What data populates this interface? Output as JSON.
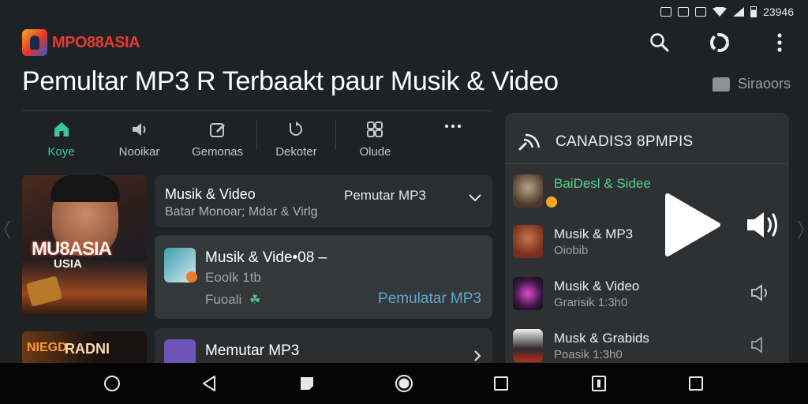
{
  "status": {
    "time": "23946"
  },
  "brand": {
    "name": "MPO88ASIA"
  },
  "header": {
    "title": "Pemultar MP3 R Terbaakt paur Musik & Video",
    "sort_label": "Siraoors"
  },
  "tabs": [
    {
      "label": "Koye",
      "icon": "home-icon",
      "active": true
    },
    {
      "label": "Nooikar",
      "icon": "volume-icon"
    },
    {
      "label": "Gemonas",
      "icon": "edit-box-icon"
    },
    {
      "label": "Dekoter",
      "icon": "refresh-icon"
    },
    {
      "label": "Olude",
      "icon": "grid-icon"
    },
    {
      "label": "",
      "icon": "more-horizontal-icon"
    }
  ],
  "thumbnails": {
    "big_caption": "MU8ASIA",
    "big_caption2": "USIA",
    "small_caption_left": "NIEGD",
    "small_caption": "RADNI"
  },
  "cards": {
    "card1": {
      "title": "Musik & Video",
      "subtitle": "Batar Monoar; Mdar & Virlg",
      "right_label": "Pemutar MP3"
    },
    "card2": {
      "title": "Musik & Vide•08 –",
      "subtitle": "Eoolk 1tb",
      "meta": "Fuoali",
      "action": "Pemulatar MP3"
    },
    "card3": {
      "title": "Memutar MP3"
    }
  },
  "panel": {
    "title": "CANADIS3 8PMPIS",
    "rows": [
      {
        "title": "BaiDesl & Sidee",
        "subtitle": ""
      },
      {
        "title": "Musik & MP3",
        "subtitle": "Oiobib"
      },
      {
        "title": "Musik & Video",
        "subtitle": "Grarisik 1:3h0"
      },
      {
        "title": "Musk & Grabids",
        "subtitle": "Poasik 1:3h0"
      }
    ]
  },
  "colors": {
    "accent": "#37c79a",
    "brand": "#e53935",
    "link": "#62a8c8"
  }
}
